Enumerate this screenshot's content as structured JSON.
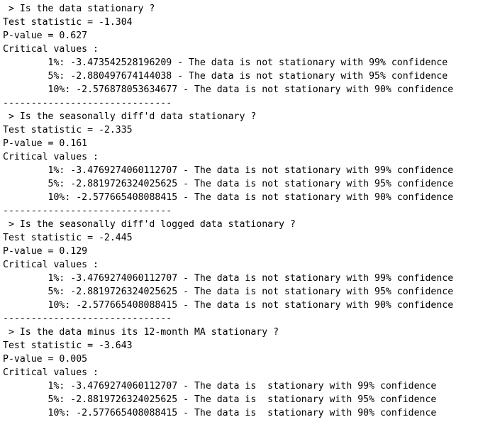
{
  "output": {
    "lines": [
      " > Is the data stationary ?",
      "Test statistic = -1.304",
      "P-value = 0.627",
      "Critical values :",
      "\t1%: -3.473542528196209 - The data is not stationary with 99% confidence",
      "\t5%: -2.880497674144038 - The data is not stationary with 95% confidence",
      "\t10%: -2.576878053634677 - The data is not stationary with 90% confidence",
      "------------------------------",
      " > Is the seasonally diff'd data stationary ?",
      "Test statistic = -2.335",
      "P-value = 0.161",
      "Critical values :",
      "\t1%: -3.4769274060112707 - The data is not stationary with 99% confidence",
      "\t5%: -2.8819726324025625 - The data is not stationary with 95% confidence",
      "\t10%: -2.577665408088415 - The data is not stationary with 90% confidence",
      "------------------------------",
      " > Is the seasonally diff'd logged data stationary ?",
      "Test statistic = -2.445",
      "P-value = 0.129",
      "Critical values :",
      "\t1%: -3.4769274060112707 - The data is not stationary with 99% confidence",
      "\t5%: -2.8819726324025625 - The data is not stationary with 95% confidence",
      "\t10%: -2.577665408088415 - The data is not stationary with 90% confidence",
      "------------------------------",
      " > Is the data minus its 12-month MA stationary ?",
      "Test statistic = -3.643",
      "P-value = 0.005",
      "Critical values :",
      "\t1%: -3.4769274060112707 - The data is  stationary with 99% confidence",
      "\t5%: -2.8819726324025625 - The data is  stationary with 95% confidence",
      "\t10%: -2.577665408088415 - The data is  stationary with 90% confidence"
    ]
  }
}
